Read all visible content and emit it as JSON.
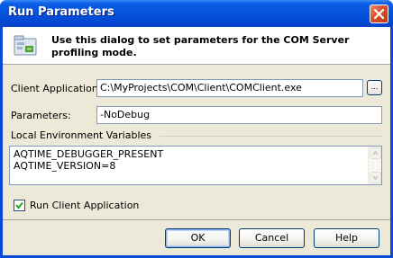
{
  "window": {
    "title": "Run Parameters"
  },
  "header": {
    "text": "Use this dialog to set parameters for the COM Server profiling mode."
  },
  "client_application": {
    "label": "Client Application:",
    "value": "C:\\MyProjects\\COM\\Client\\COMClient.exe",
    "browse_label": "..."
  },
  "parameters": {
    "label": "Parameters:",
    "value": "-NoDebug"
  },
  "env_vars": {
    "label": "Local Environment Variables",
    "lines": [
      "AQTIME_DEBUGGER_PRESENT",
      "AQTIME_VERSION=8"
    ]
  },
  "run_client": {
    "label": "Run Client Application",
    "checked": true
  },
  "buttons": {
    "ok": "OK",
    "cancel": "Cancel",
    "help": "Help"
  }
}
